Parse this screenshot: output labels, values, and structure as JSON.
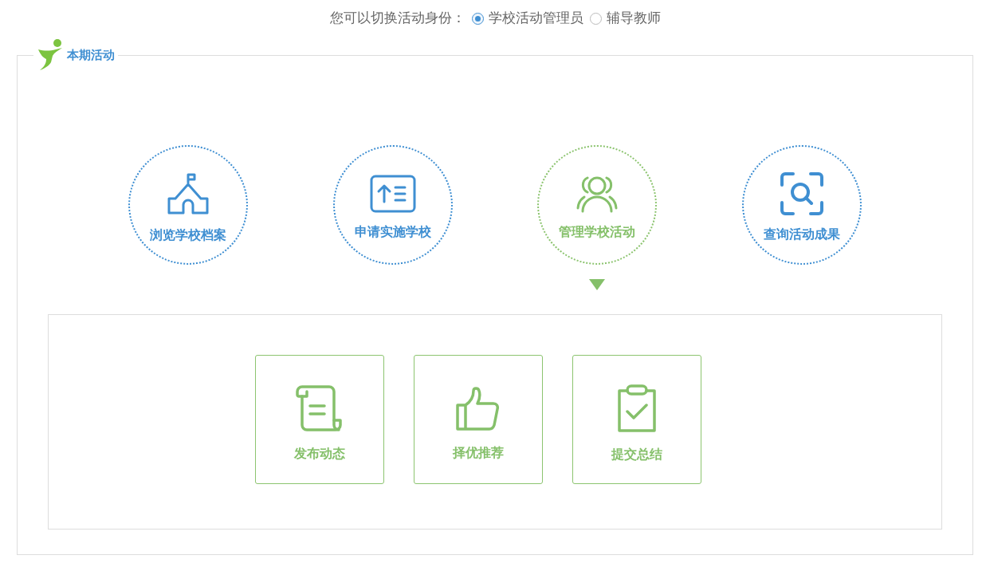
{
  "role_switch": {
    "label": "您可以切换活动身份：",
    "options": [
      {
        "label": "学校活动管理员",
        "selected": true
      },
      {
        "label": "辅导教师",
        "selected": false
      }
    ]
  },
  "panel": {
    "title": "本期活动"
  },
  "activities": [
    {
      "kind": "school",
      "label": "浏览学校档案",
      "selected": false
    },
    {
      "kind": "apply",
      "label": "申请实施学校",
      "selected": false
    },
    {
      "kind": "people",
      "label": "管理学校活动",
      "selected": true
    },
    {
      "kind": "search",
      "label": "查询活动成果",
      "selected": false
    }
  ],
  "actions": [
    {
      "kind": "scroll",
      "label": "发布动态"
    },
    {
      "kind": "thumb",
      "label": "择优推荐"
    },
    {
      "kind": "clipboard",
      "label": "提交总结"
    }
  ]
}
